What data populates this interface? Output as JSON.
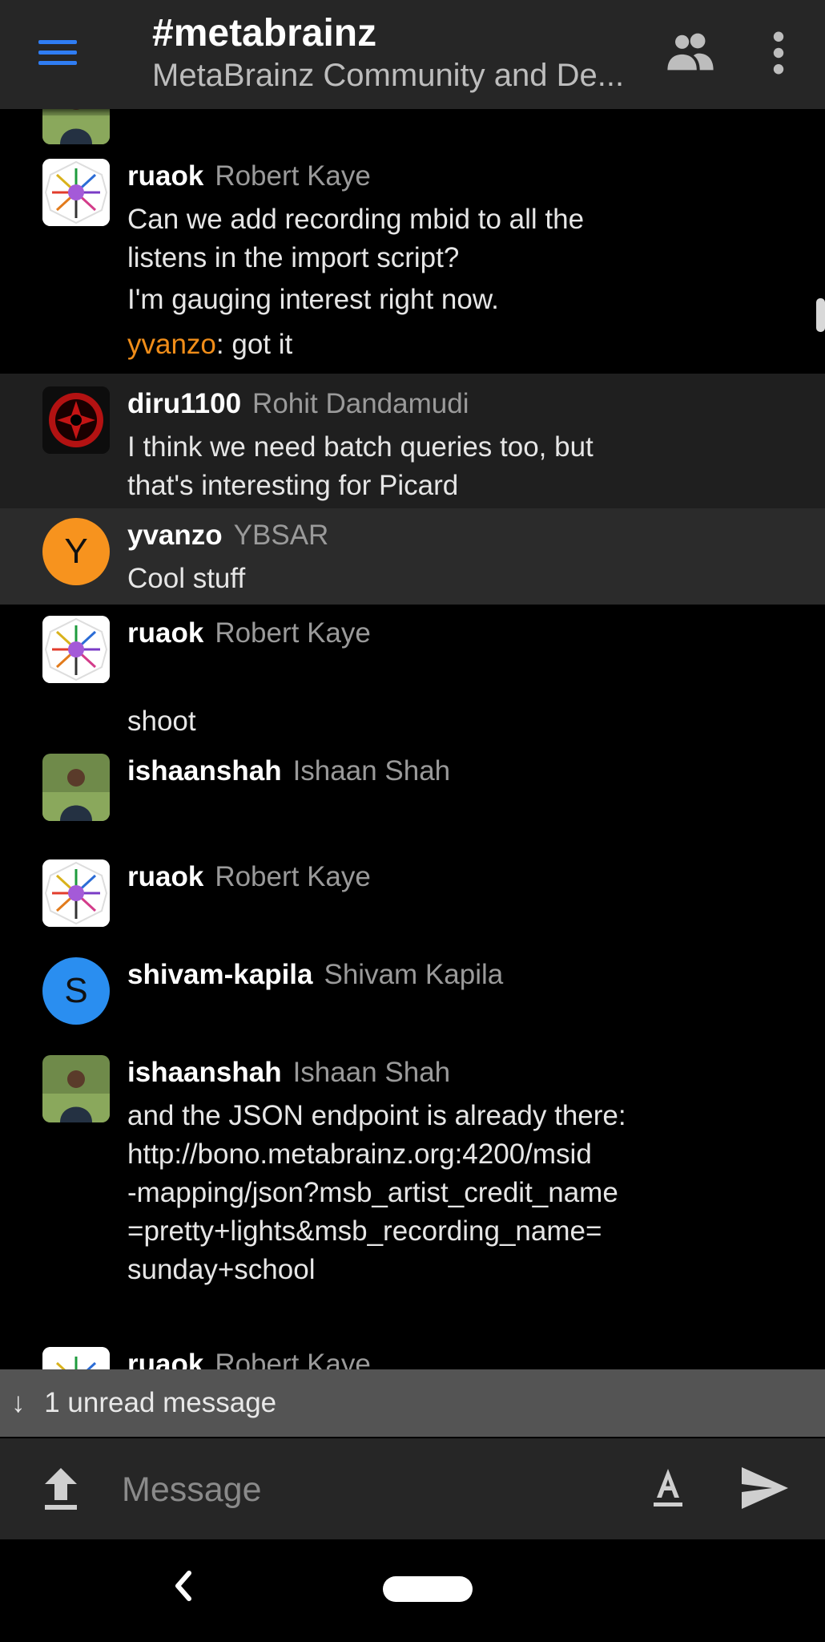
{
  "header": {
    "title": "#metabrainz",
    "subtitle": "MetaBrainz Community and De..."
  },
  "icons": {
    "menu": "hamburger-menu-icon",
    "people": "people-icon",
    "more": "more-vert-icon",
    "upload": "upload-icon",
    "format": "text-format-icon",
    "send": "send-icon",
    "back": "back-chevron-icon"
  },
  "colors": {
    "accent": "#2f7df3",
    "mention": "#f08d19",
    "avatar_y": "#f7931e",
    "avatar_s": "#2a8ef0"
  },
  "messages": [
    {
      "user": "ruaok",
      "name": "Robert Kaye",
      "lines": [
        "Can we add recording mbid to all the",
        "listens in the import script?",
        "I'm gauging interest right now."
      ],
      "reply_mention": "yvanzo",
      "reply_text": ": got it"
    },
    {
      "user": "diru1100",
      "name": "Rohit Dandamudi",
      "lines": [
        "I think we need batch queries too, but",
        "that's interesting for Picard"
      ]
    },
    {
      "user": "yvanzo",
      "name": "YBSAR",
      "avatar_letter": "Y",
      "lines": [
        "Cool stuff"
      ]
    },
    {
      "user": "ruaok",
      "name": "Robert Kaye",
      "lines": [
        "shoot"
      ]
    },
    {
      "user": "ishaanshah",
      "name": "Ishaan Shah"
    },
    {
      "user": "ruaok",
      "name": "Robert Kaye"
    },
    {
      "user": "shivam-kapila",
      "name": "Shivam Kapila",
      "avatar_letter": "S"
    },
    {
      "user": "ishaanshah",
      "name": "Ishaan Shah",
      "lines": [
        "and the JSON endpoint is already there:",
        "http://bono.metabrainz.org:4200/msid",
        "-mapping/json?msb_artist_credit_name",
        "=pretty+lights&msb_recording_name=",
        "sunday+school"
      ]
    },
    {
      "user": "ruaok",
      "name": "Robert Kaye"
    }
  ],
  "unread_banner": {
    "arrow": "↓",
    "text": "1 unread message"
  },
  "composer": {
    "placeholder": "Message"
  }
}
